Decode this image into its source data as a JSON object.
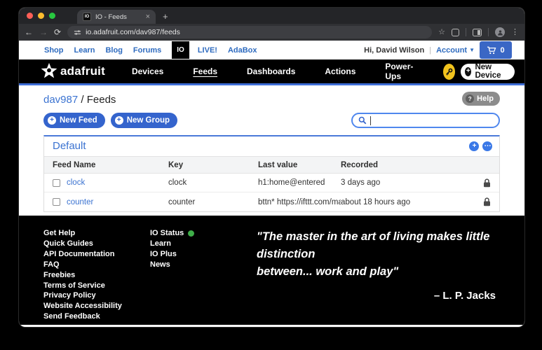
{
  "browser": {
    "tab_title": "IO - Feeds",
    "favicon_text": "IO",
    "close_glyph": "×",
    "new_tab_glyph": "+",
    "back_glyph": "←",
    "forward_glyph": "→",
    "refresh_glyph": "⟳",
    "url": "io.adafruit.com/dav987/feeds",
    "bookmark_glyph": "☆",
    "menu_glyph": "⋮"
  },
  "siteheader": {
    "links": [
      "Shop",
      "Learn",
      "Blog",
      "Forums"
    ],
    "io_badge": "IO",
    "links2": [
      "LIVE!",
      "AdaBox"
    ],
    "greeting": "Hi, David Wilson",
    "divider": "|",
    "account": "Account",
    "account_caret": "▼",
    "cart_count": "0"
  },
  "navbar": {
    "brand": "adafruit",
    "items": [
      {
        "label": "Devices"
      },
      {
        "label": "Feeds"
      },
      {
        "label": "Dashboards"
      },
      {
        "label": "Actions"
      },
      {
        "label": "Power-Ups"
      }
    ],
    "new_device_label": "New Device",
    "plus_glyph": "+"
  },
  "page": {
    "breadcrumb_user": "dav987",
    "breadcrumb_sep": " / ",
    "breadcrumb_page": "Feeds",
    "help_label": "Help",
    "help_glyph": "?",
    "new_feed_label": "New Feed",
    "new_group_label": "New Group",
    "button_plus_glyph": "+",
    "search_value": ""
  },
  "group": {
    "title": "Default",
    "add_glyph": "+",
    "more_glyph": "⋯",
    "columns": [
      "Feed Name",
      "Key",
      "Last value",
      "Recorded"
    ],
    "rows": [
      {
        "name": "clock",
        "key": "clock",
        "last": "h1:home@entered",
        "recorded": "3 days ago"
      },
      {
        "name": "counter",
        "key": "counter",
        "last": "bttn* https://ifttt.com/map...",
        "recorded": "about 18 hours ago"
      }
    ]
  },
  "footer": {
    "links_col1": [
      "Get Help",
      "Quick Guides",
      "API Documentation",
      "FAQ",
      "Freebies",
      "Terms of Service",
      "Privacy Policy",
      "Website Accessibility",
      "Send Feedback"
    ],
    "io_status": "IO Status",
    "links_col2": [
      "Learn",
      "IO Plus",
      "News"
    ],
    "quote_line1": "\"The master in the art of living makes little distinction",
    "quote_line2": "between... work and play\"",
    "attribution": "– L. P. Jacks"
  },
  "colors": {
    "accent_blue": "#3464cd",
    "link_blue": "#3b73d1",
    "search_border": "#4f87ee",
    "nav_underline": "#3e6ed8",
    "key_yellow": "#f2c31d",
    "status_green": "#3fae49"
  }
}
